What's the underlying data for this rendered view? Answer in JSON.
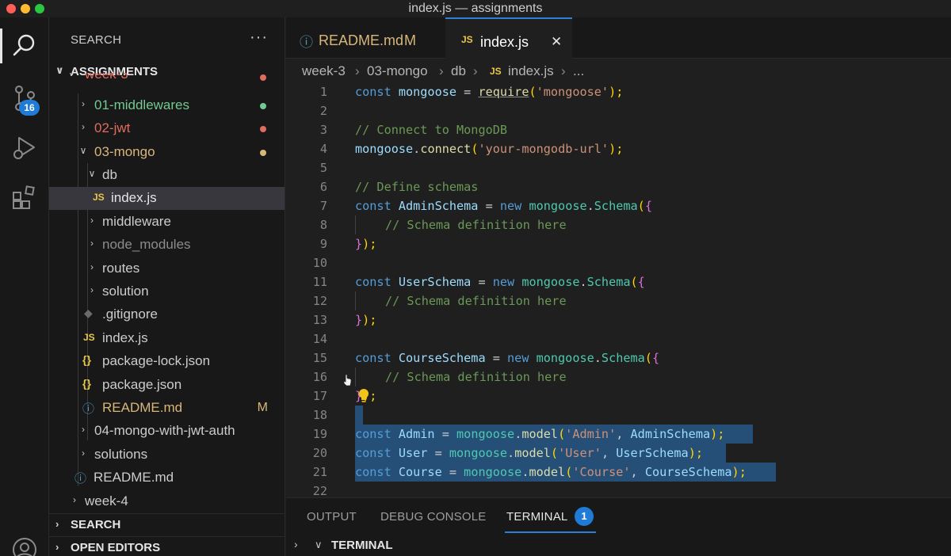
{
  "window": {
    "title": "index.js — assignments"
  },
  "activity_bar": {
    "items": [
      {
        "icon": "search-icon",
        "active": true
      },
      {
        "icon": "source-control-icon",
        "badge": "16"
      },
      {
        "icon": "run-debug-icon"
      },
      {
        "icon": "extensions-icon"
      },
      {
        "icon": "account-icon"
      }
    ]
  },
  "sidebar": {
    "title": "SEARCH",
    "more": "···",
    "root": "ASSIGNMENTS",
    "tree": [
      {
        "label": "week-3",
        "kind": "folder",
        "status": "modified"
      },
      {
        "label": "01-middlewares",
        "kind": "folder",
        "status": "untracked"
      },
      {
        "label": "02-jwt",
        "kind": "folder",
        "status": "error"
      },
      {
        "label": "03-mongo",
        "kind": "folder",
        "status": "modified"
      },
      {
        "label": "db",
        "kind": "folder"
      },
      {
        "label": "index.js",
        "kind": "js",
        "selected": true
      },
      {
        "label": "middleware",
        "kind": "folder"
      },
      {
        "label": "node_modules",
        "kind": "folder"
      },
      {
        "label": "routes",
        "kind": "folder"
      },
      {
        "label": "solution",
        "kind": "folder"
      },
      {
        "label": ".gitignore",
        "kind": "git"
      },
      {
        "label": "index.js",
        "kind": "js"
      },
      {
        "label": "package-lock.json",
        "kind": "json"
      },
      {
        "label": "package.json",
        "kind": "json"
      },
      {
        "label": "README.md",
        "kind": "info",
        "flag": "M"
      },
      {
        "label": "04-mongo-with-jwt-auth",
        "kind": "folder"
      },
      {
        "label": "solutions",
        "kind": "folder"
      },
      {
        "label": "README.md",
        "kind": "info"
      },
      {
        "label": "week-4",
        "kind": "folder"
      }
    ],
    "collapsed_sections": [
      "SEARCH",
      "OPEN EDITORS"
    ]
  },
  "tabs": [
    {
      "label": "README.md",
      "flag": "M",
      "icon": "info-icon"
    },
    {
      "label": "index.js",
      "icon": "js-icon",
      "active": true,
      "close": "✕"
    }
  ],
  "breadcrumb": [
    "week-3",
    "03-mongo",
    "db",
    "index.js",
    "..."
  ],
  "editor": {
    "line_numbers": [
      "1",
      "2",
      "3",
      "4",
      "5",
      "6",
      "7",
      "8",
      "9",
      "10",
      "11",
      "12",
      "13",
      "14",
      "15",
      "16",
      "17",
      "18",
      "19",
      "20",
      "21",
      "22"
    ],
    "lines": {
      "l1": {
        "a": "const",
        "b": " mongoose ",
        "c": "= ",
        "d": "require",
        "e": "(",
        "f": "'mongoose'",
        "g": ");"
      },
      "l3": "// Connect to MongoDB",
      "l4": {
        "a": "mongoose",
        "b": ".",
        "c": "connect",
        "d": "(",
        "e": "'your-mongodb-url'",
        "f": ");"
      },
      "l6": "// Define schemas",
      "l7": {
        "a": "const",
        "b": " AdminSchema ",
        "c": "= ",
        "d": "new",
        "e": " mongoose",
        "f": ".",
        "g": "Schema",
        "h": "(",
        "i": "{"
      },
      "l8": "// Schema definition here",
      "l9": {
        "a": "}",
        "b": ");"
      },
      "l11": {
        "a": "const",
        "b": " UserSchema ",
        "c": "= ",
        "d": "new",
        "e": " mongoose",
        "f": ".",
        "g": "Schema",
        "h": "(",
        "i": "{"
      },
      "l12": "// Schema definition here",
      "l13": {
        "a": "}",
        "b": ");"
      },
      "l15": {
        "a": "const",
        "b": " CourseSchema ",
        "c": "= ",
        "d": "new",
        "e": " mongoose",
        "f": ".",
        "g": "Schema",
        "h": "(",
        "i": "{"
      },
      "l16": "// Schema definition here",
      "l17": {
        "a": "}",
        "b": ");"
      },
      "l19": {
        "a": "const",
        "b": " Admin ",
        "c": "= ",
        "d": "mongoose",
        "e": ".",
        "f": "model",
        "g": "(",
        "h": "'Admin'",
        "i": ", ",
        "j": "AdminSchema",
        "k": ");"
      },
      "l20": {
        "a": "const",
        "b": " User ",
        "c": "= ",
        "d": "mongoose",
        "e": ".",
        "f": "model",
        "g": "(",
        "h": "'User'",
        "i": ", ",
        "j": "UserSchema",
        "k": ");"
      },
      "l21": {
        "a": "const",
        "b": " Course ",
        "c": "= ",
        "d": "mongoose",
        "e": ".",
        "f": "model",
        "g": "(",
        "h": "'Course'",
        "i": ", ",
        "j": "CourseSchema",
        "k": ");"
      }
    }
  },
  "panel": {
    "tabs": [
      "OUTPUT",
      "DEBUG CONSOLE",
      "TERMINAL"
    ],
    "active_tab": "TERMINAL",
    "terminal_badge": "1",
    "section_label": "TERMINAL"
  },
  "colors": {
    "accent": "#2f7fd6",
    "modified": "#d7b77a",
    "untracked": "#73c991",
    "error": "#e06c5f"
  }
}
